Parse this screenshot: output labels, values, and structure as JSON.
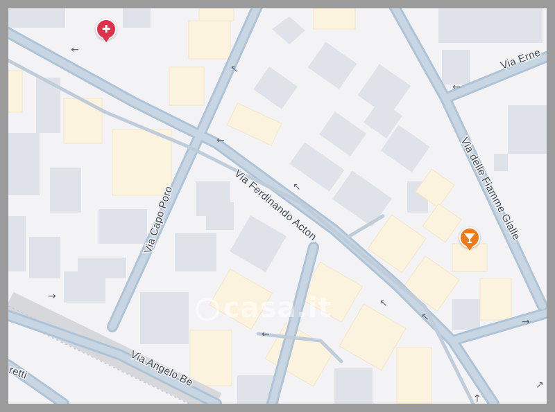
{
  "streets": {
    "ferdinando_acton": "Via Ferdinando Acton",
    "capo_poro": "Via Capo Poro",
    "fiamme_gialle": "Via delle Fiamme Gialle",
    "angelo_be": "Via Angelo Be",
    "erne": "Via Erne",
    "retti": "retti"
  },
  "watermark": "casa.it",
  "pois": [
    {
      "name": "hospital",
      "icon": "hospital-cross-icon",
      "glyph": "✚",
      "color": "#e0314a"
    },
    {
      "name": "bar",
      "icon": "cocktail-glass-icon",
      "glyph": "🍸",
      "color": "#ee7b17"
    }
  ],
  "colors": {
    "road": "#aec3d6",
    "road_fill": "#c8d6e3",
    "building_gray": "#dfe2e8",
    "building_yellow": "#fcf3de",
    "background": "#f3f3f5"
  }
}
